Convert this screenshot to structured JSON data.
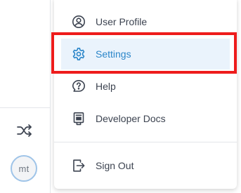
{
  "rail": {
    "shuffle_icon": "shuffle-icon",
    "avatar_initials": "mt"
  },
  "menu": {
    "items": [
      {
        "label": "User Profile",
        "icon": "user-circle-icon"
      },
      {
        "label": "Settings",
        "icon": "gear-icon",
        "active": true
      },
      {
        "label": "Help",
        "icon": "question-bubble-icon"
      },
      {
        "label": "Developer Docs",
        "icon": "docs-icon"
      },
      {
        "label": "Sign Out",
        "icon": "sign-out-icon"
      }
    ]
  },
  "colors": {
    "accent": "#2b86c9",
    "active_bg": "#eaf3fc",
    "highlight_box": "#ee1c1c",
    "text": "#3c4350"
  }
}
